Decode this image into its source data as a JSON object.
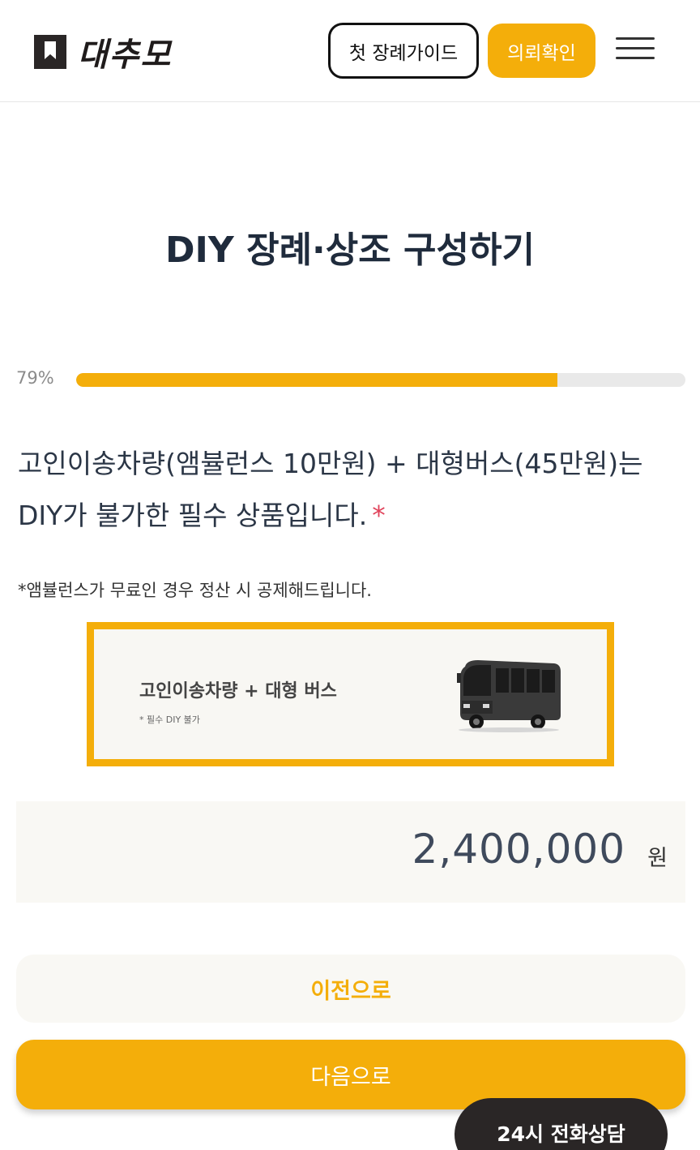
{
  "header": {
    "logo_text": "대추모",
    "guide_button": "첫 장례가이드",
    "confirm_button": "의뢰확인",
    "menu_icon": "hamburger-menu-icon"
  },
  "page": {
    "title": "DIY 장례·상조 구성하기"
  },
  "progress": {
    "label": "79%",
    "percent": 79
  },
  "question": {
    "line1": "고인이송차량(앰뷸런스 10만원) + 대형버스(45만원)는",
    "line2": "DIY가 불가한 필수 상품입니다.",
    "required_mark": "*",
    "note": "*앰뷸런스가 무료인 경우 정산 시 공제해드립니다."
  },
  "product": {
    "name": "고인이송차량 + 대형 버스",
    "sub": "* 필수 DIY 불가",
    "icon": "bus-icon",
    "border_color": "#f4ae0a"
  },
  "price": {
    "value": "2,400,000",
    "unit": "원"
  },
  "buttons": {
    "prev": "이전으로",
    "next": "다음으로",
    "call": "24시 전화상담"
  },
  "colors": {
    "accent": "#f4ae0a",
    "required": "#e0435b",
    "dark": "#2a2626"
  }
}
